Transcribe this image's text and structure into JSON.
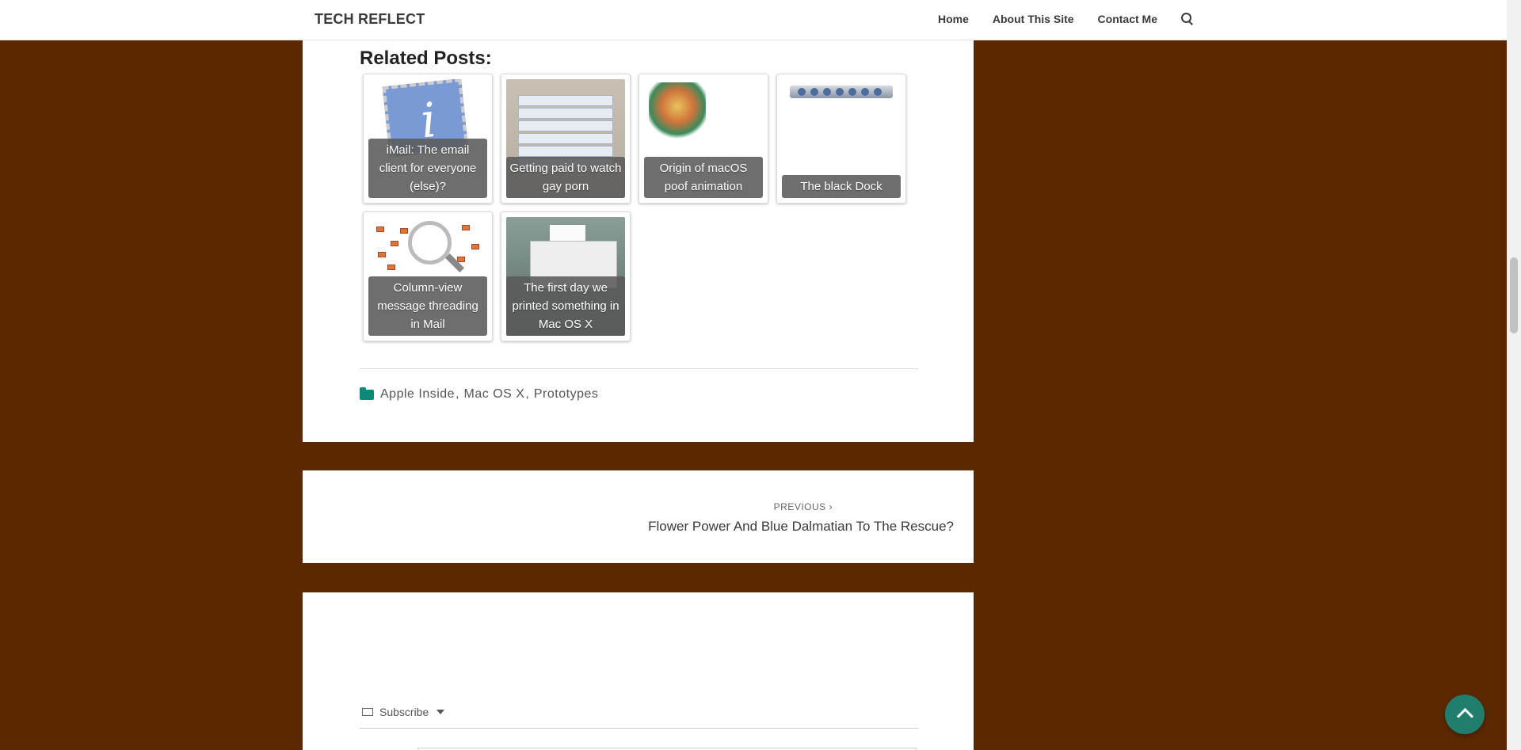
{
  "header": {
    "site_title": "TECH REFLECT",
    "nav": [
      "Home",
      "About This Site",
      "Contact Me"
    ]
  },
  "related": {
    "title": "Related Posts:",
    "posts": [
      {
        "title": "iMail: The email client for everyone (else)?"
      },
      {
        "title": "Getting paid to watch gay porn"
      },
      {
        "title": "Origin of macOS poof animation"
      },
      {
        "title": "The black Dock"
      },
      {
        "title": "Column-view message threading in Mail"
      },
      {
        "title": "The first day we printed something in Mac OS X"
      }
    ]
  },
  "categories": [
    "Apple Inside",
    "Mac OS X",
    "Prototypes"
  ],
  "post_nav": {
    "previous_label": "PREVIOUS",
    "previous_title": "Flower Power And Blue Dalmatian To The Rescue?"
  },
  "comments": {
    "subscribe_label": "Subscribe"
  },
  "colors": {
    "background": "#5c2800",
    "accent": "#1f7e6c",
    "folder_icon": "#0b8a78"
  }
}
